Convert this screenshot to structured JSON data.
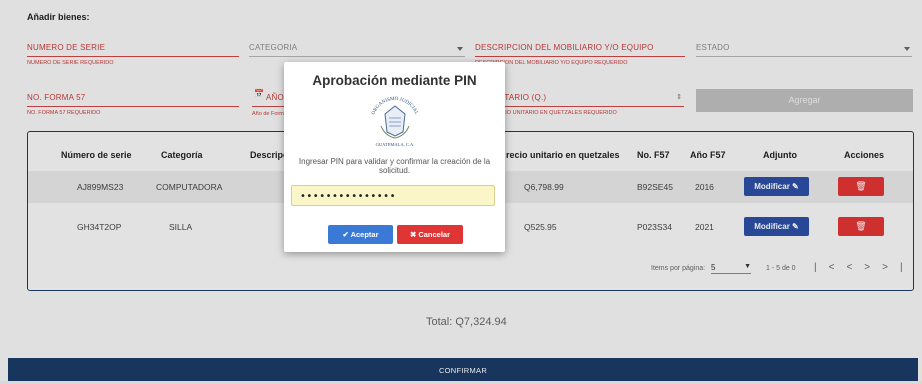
{
  "form": {
    "section_title": "Añadir bienes:",
    "serial": {
      "label": "NUMERO DE SERIE",
      "error": "NUMERO DE SERIE REQUERIDO"
    },
    "category": {
      "label": "CATEGORIA"
    },
    "description": {
      "label": "DESCRIPCION DEL MOBILIARIO Y/O EQUIPO",
      "error": "DESCRIPCION DEL MOBILIARIO Y/O EQUIPO REQUERIDO"
    },
    "state": {
      "label": "ESTADO"
    },
    "form57": {
      "label": "NO. FORMA 57",
      "error": "NO. FORMA 57 REQUERIDO"
    },
    "year": {
      "label": "AÑO",
      "error": "Año de Forma"
    },
    "price": {
      "label": "UNITARIO (Q.)",
      "error": "PRECIO UNITARIO EN QUETZALES REQUERIDO"
    },
    "add_button": "Agregar"
  },
  "table": {
    "headers": [
      "Número de serie",
      "Categoría",
      "Descripci",
      "recio unitario en quetzales",
      "No. F57",
      "Año F57",
      "Adjunto",
      "Acciones"
    ],
    "rows": [
      {
        "serial": "AJ899MS23",
        "category": "COMPUTADORA",
        "price": "Q6,798.99",
        "f57": "B92SE45",
        "year": "2016",
        "attach_label": "Modificar"
      },
      {
        "serial": "GH34T2OP",
        "category": "SILLA",
        "price": "Q525.95",
        "f57": "P023S34",
        "year": "2021",
        "attach_label": "Modificar"
      }
    ],
    "pager": {
      "items_label": "Items por página:",
      "items_value": "5",
      "range": "1 - 5 de 0"
    }
  },
  "total": "Total: Q7,324.94",
  "confirm_button": "CONFIRMAR",
  "modal": {
    "title": "Aprobación mediante PIN",
    "text": "Ingresar PIN para validar y confirmar la creación de la solicitud.",
    "pin_value": "•••••••••••••••",
    "accept_label": "✔ Aceptar",
    "cancel_label": "✖ Cancelar",
    "seal": {
      "top_text": "ORGANISMO JUDICIAL",
      "bottom_text": "GUATEMALA, C.A."
    }
  },
  "colors": {
    "primary": "#1b3a66",
    "danger": "#e03535",
    "accent": "#2c4ea3",
    "error": "#c63b3b"
  }
}
